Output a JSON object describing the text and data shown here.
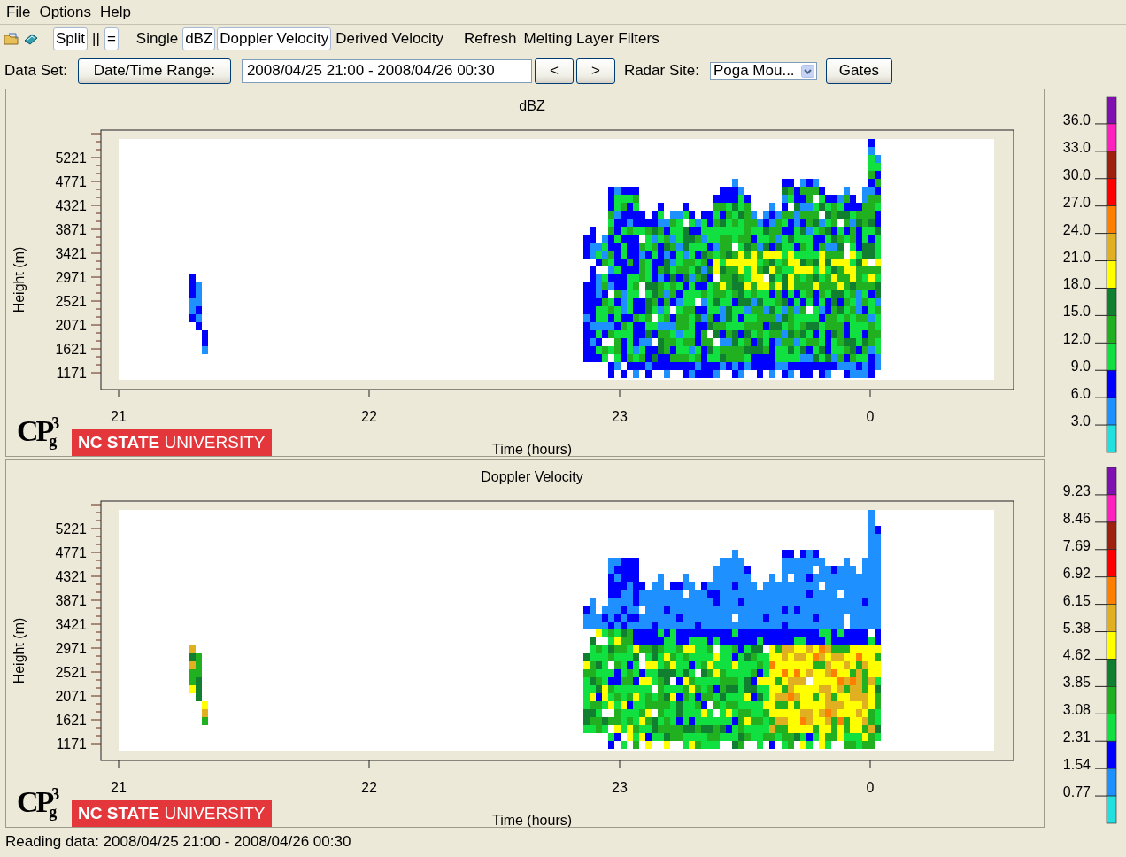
{
  "menu": [
    "File",
    "Options",
    "Help"
  ],
  "toolbar": [
    {
      "label": "Split",
      "selected": true
    },
    {
      "label": "||",
      "selected": false
    },
    {
      "label": "=",
      "selected": true
    },
    {
      "label": "Single",
      "selected": false
    },
    {
      "label": "dBZ",
      "selected": true
    },
    {
      "label": "Doppler Velocity",
      "selected": true
    },
    {
      "label": "Derived Velocity",
      "selected": false
    },
    {
      "label": "Refresh",
      "selected": false
    },
    {
      "label": "Melting Layer Filters",
      "selected": false
    }
  ],
  "dataset": {
    "label": "Data Set:",
    "range_button": "Date/Time Range:",
    "range_value": "2008/04/25 21:00 - 2008/04/26 00:30",
    "prev_button": "<",
    "next_button": ">",
    "site_label": "Radar Site:",
    "site_value": "Poga Mou...",
    "gates_button": "Gates"
  },
  "panels": [
    {
      "kind": "reflectivity",
      "title": "dBZ",
      "ylabel": "Height (m)",
      "xlabel": "Time (hours)",
      "yticks": [
        "5221",
        "4771",
        "4321",
        "3871",
        "3421",
        "2971",
        "2521",
        "2071",
        "1621",
        "1171"
      ],
      "xticks": [
        "21",
        "22",
        "23",
        "0"
      ],
      "logo": "CP$^{3}$$_{g}$",
      "banner": "**NC STATE** UNIVERSITY",
      "colorbar": {
        "labels": [
          "36.0",
          "33.0",
          "30.0",
          "27.0",
          "24.0",
          "21.0",
          "18.0",
          "15.0",
          "12.0",
          "9.0",
          "6.0",
          "3.0"
        ],
        "colors": [
          {
            "color": "#8010b0"
          },
          {
            "color": "#ff20c0"
          },
          {
            "color": "#a02010"
          },
          {
            "color": "#ff0000"
          },
          {
            "color": "#ff8000"
          },
          {
            "color": "#e0b020"
          },
          {
            "color": "#ffff00"
          },
          {
            "color": "#108030"
          },
          {
            "color": "#20b020"
          },
          {
            "color": "#10e040"
          },
          {
            "color": "#0000ff"
          },
          {
            "color": "#1e90ff"
          },
          {
            "color": "#22e0e0"
          }
        ]
      }
    },
    {
      "kind": "velocity",
      "title": "Doppler Velocity",
      "ylabel": "Height (m)",
      "xlabel": "Time (hours)",
      "yticks": [
        "5221",
        "4771",
        "4321",
        "3871",
        "3421",
        "2971",
        "2521",
        "2071",
        "1621",
        "1171"
      ],
      "xticks": [
        "21",
        "22",
        "23",
        "0"
      ],
      "logo": "CP$^{3}$$_{g}$",
      "banner": "**NC STATE** UNIVERSITY",
      "colorbar": {
        "labels": [
          "9.23",
          "8.46",
          "7.69",
          "6.92",
          "6.15",
          "5.38",
          "4.62",
          "3.85",
          "3.08",
          "2.31",
          "1.54",
          "0.77"
        ],
        "colors": [
          {
            "color": "#8010b0"
          },
          {
            "color": "#ff20c0"
          },
          {
            "color": "#a02010"
          },
          {
            "color": "#ff0000"
          },
          {
            "color": "#ff8000"
          },
          {
            "color": "#e0b020"
          },
          {
            "color": "#ffff00"
          },
          {
            "color": "#108030"
          },
          {
            "color": "#20b020"
          },
          {
            "color": "#10e040"
          },
          {
            "color": "#0000ff"
          },
          {
            "color": "#1e90ff"
          },
          {
            "color": "#22e0e0"
          }
        ]
      }
    }
  ],
  "status": "Reading data: 2008/04/25 21:00 - 2008/04/26 00:30"
}
